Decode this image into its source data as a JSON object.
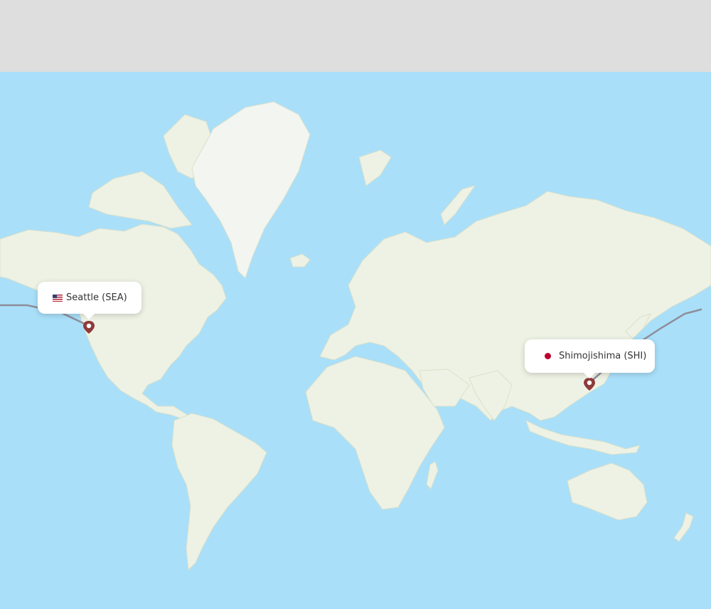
{
  "colors": {
    "ocean": "#a9dff9",
    "land": "#eef2e4",
    "ice": "#f2f5f0",
    "route": "#8e8e99",
    "pin": "#8e3b3b",
    "background": "#dedede"
  },
  "origin": {
    "label": "Seattle (SEA)",
    "flag_icon": "us-flag-icon"
  },
  "destination": {
    "label": "Shimojishima (SHI)",
    "flag_icon": "japan-flag-icon"
  }
}
